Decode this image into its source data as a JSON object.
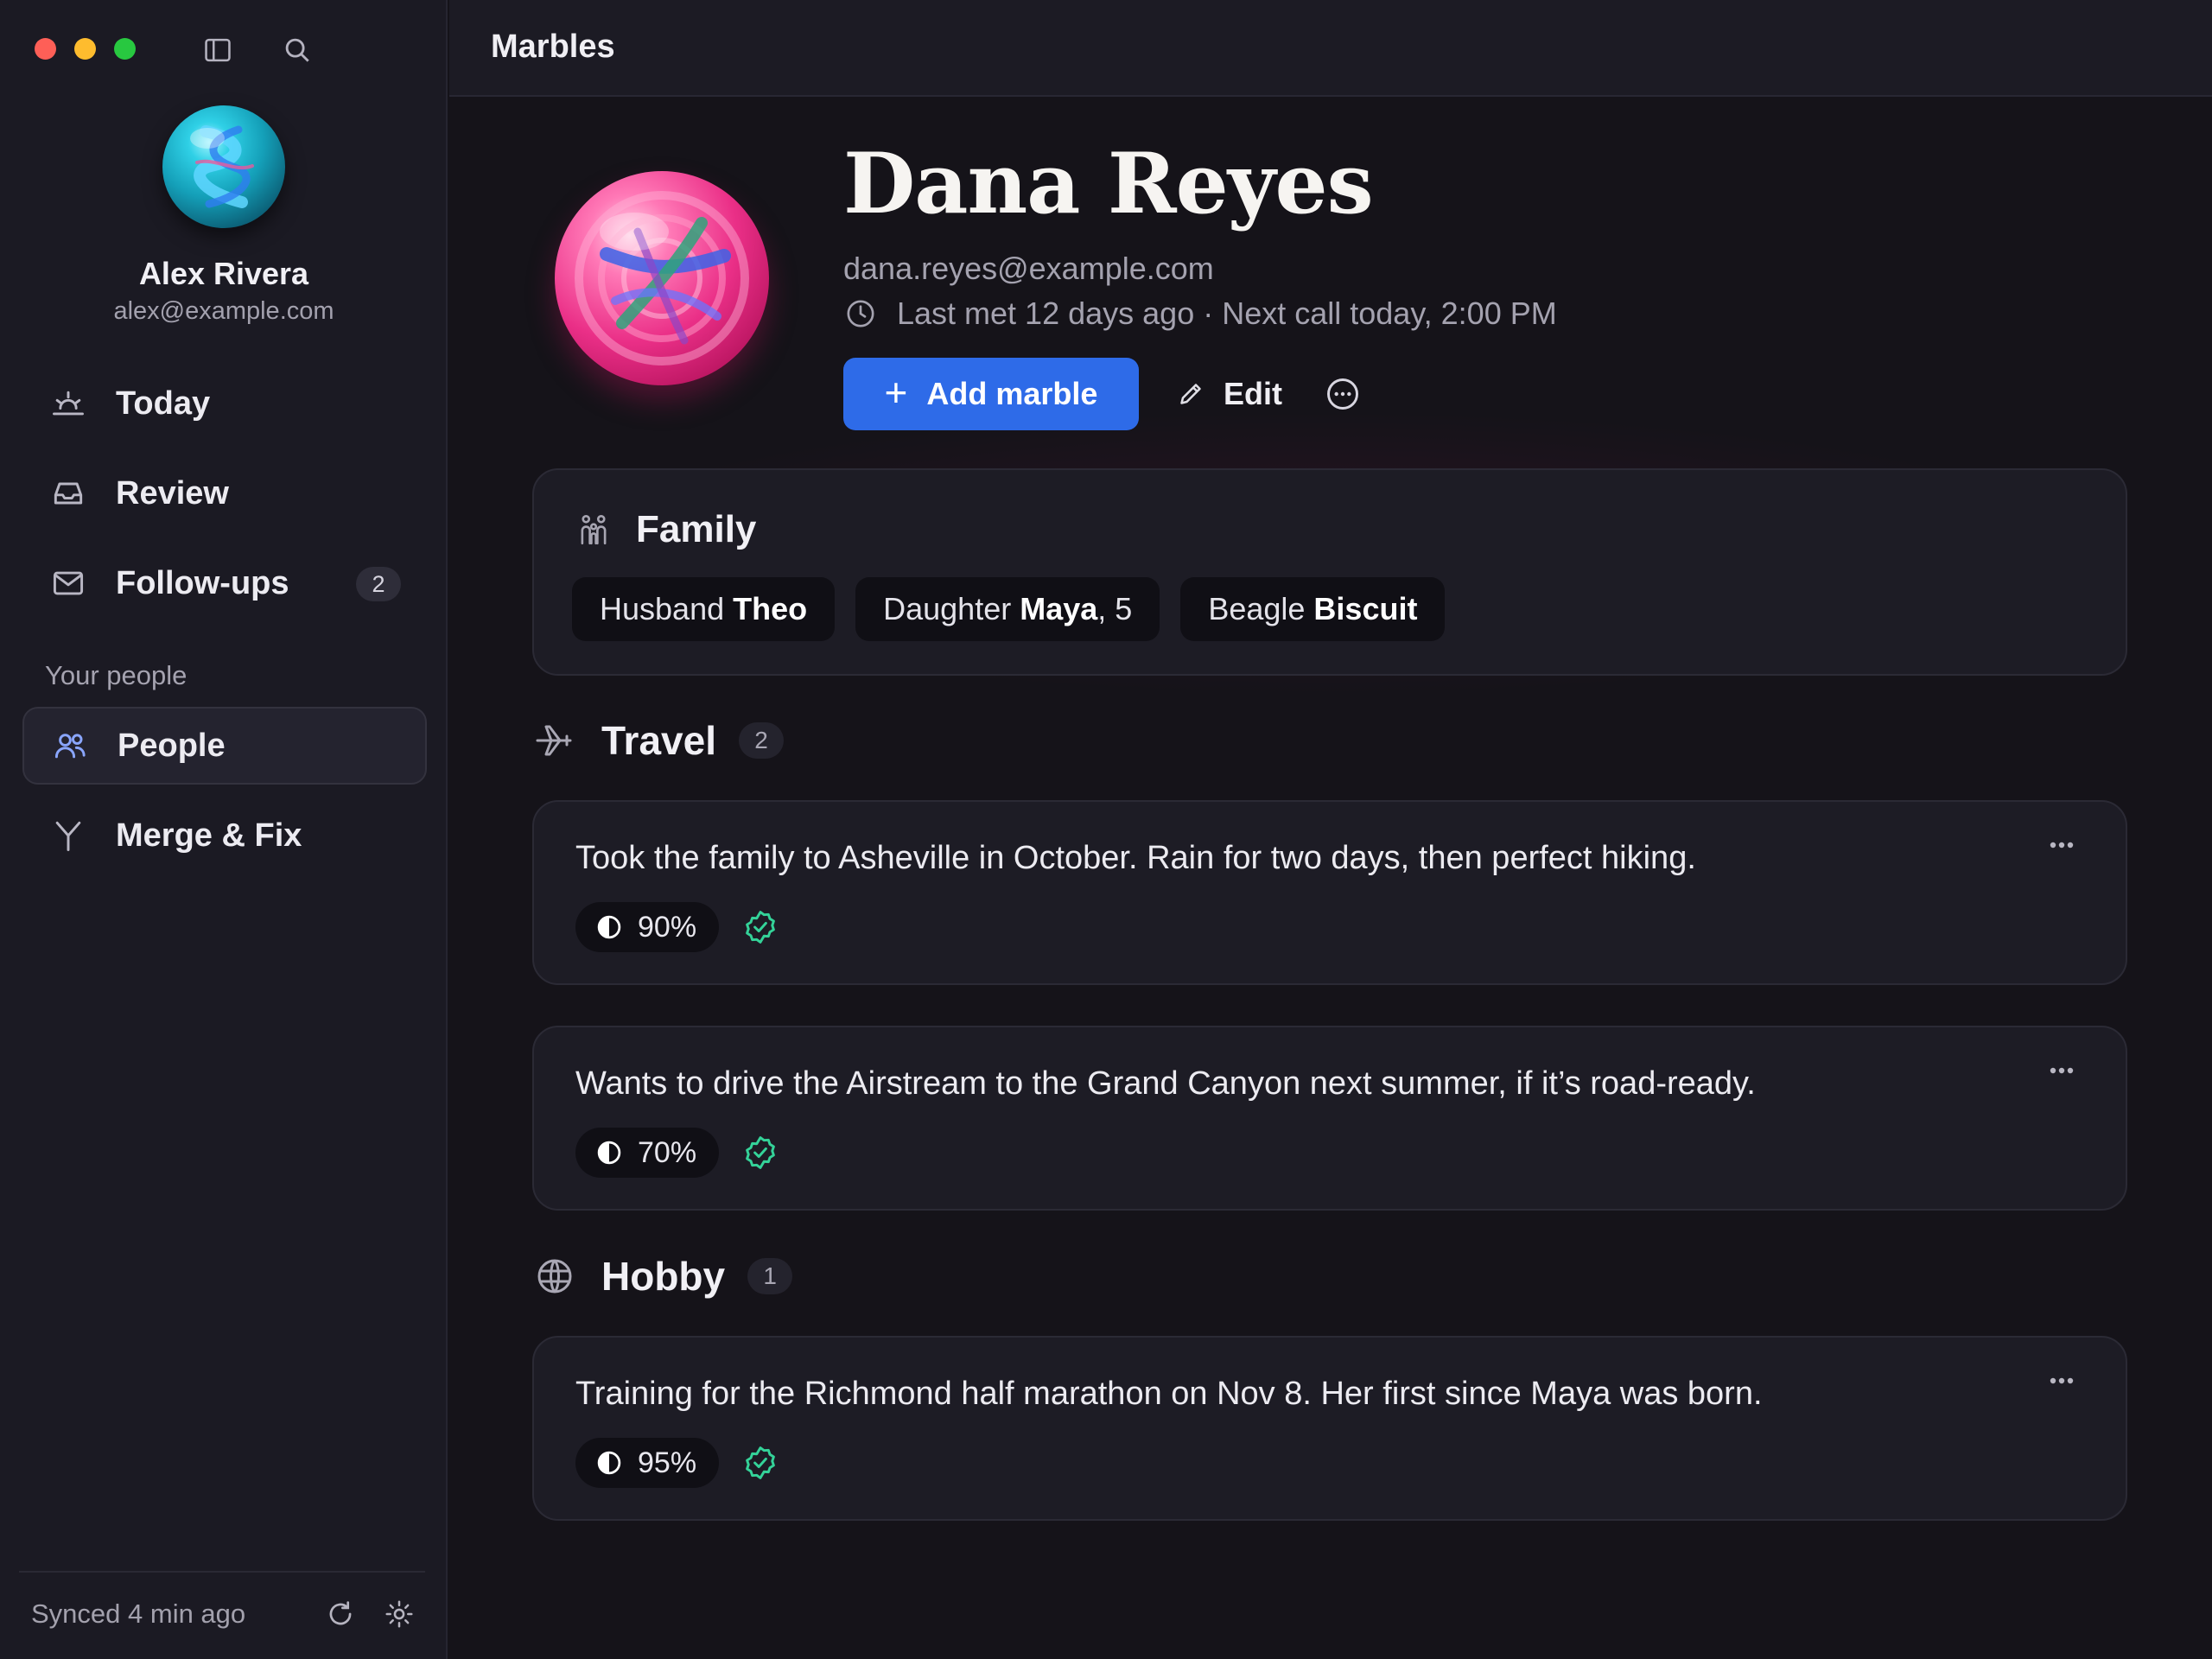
{
  "window": {
    "title": "Marbles"
  },
  "user": {
    "name": "Alex Rivera",
    "email": "alex@example.com"
  },
  "nav": {
    "today": "Today",
    "review": "Review",
    "followups": "Follow-ups",
    "followups_count": "2",
    "section_label": "Your people",
    "people": "People",
    "merge": "Merge & Fix"
  },
  "footer": {
    "sync_status": "Synced 4 min ago"
  },
  "person": {
    "name": "Dana Reyes",
    "email": "dana.reyes@example.com",
    "meta": "Last met 12 days ago · Next call today, 2:00 PM"
  },
  "actions": {
    "add": "Add marble",
    "edit": "Edit"
  },
  "family": {
    "title": "Family",
    "chips": [
      {
        "relation": "Husband",
        "name": "Theo",
        "suffix": ""
      },
      {
        "relation": "Daughter",
        "name": "Maya",
        "suffix": ", 5"
      },
      {
        "relation": "Beagle",
        "name": "Biscuit",
        "suffix": ""
      }
    ]
  },
  "travel": {
    "title": "Travel",
    "count": "2",
    "notes": [
      {
        "text": "Took the family to Asheville in October. Rain for two days, then perfect hiking.",
        "confidence": "90%"
      },
      {
        "text": "Wants to drive the Airstream to the Grand Canyon next summer, if it’s road-ready.",
        "confidence": "70%"
      }
    ]
  },
  "hobby": {
    "title": "Hobby",
    "count": "1",
    "notes": [
      {
        "text": "Training for the Richmond half marathon on Nov 8. Her first since Maya was born.",
        "confidence": "95%"
      }
    ]
  },
  "colors": {
    "accent": "#2e6be8",
    "verified": "#34d399",
    "active_nav_icon": "#8aa6ff"
  },
  "icons": {
    "sidebar_toggle": "sidebar-icon",
    "search": "search-icon",
    "today": "sunrise-icon",
    "review": "inbox-icon",
    "followups": "mail-icon",
    "people": "users-icon",
    "merge": "merge-icon",
    "refresh": "refresh-icon",
    "settings": "sun-settings-icon",
    "family": "family-icon",
    "travel": "plane-icon",
    "hobby": "globe-icon",
    "confidence": "half-circle-icon",
    "verified": "verified-badge-icon"
  }
}
